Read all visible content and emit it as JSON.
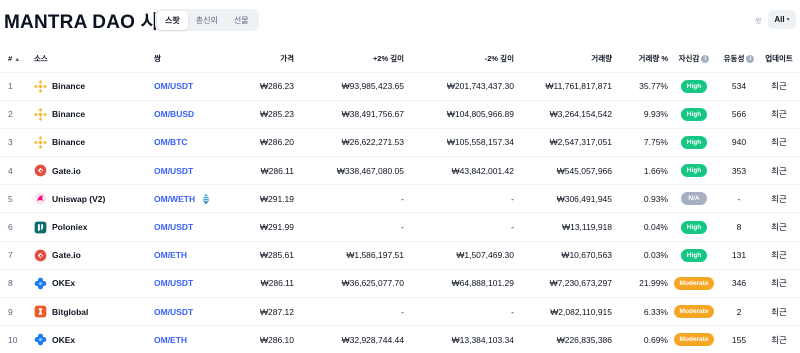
{
  "header": {
    "title": "MANTRA DAO 시장",
    "tabs": [
      {
        "label": "스팟",
        "active": true
      },
      {
        "label": "총신의",
        "active": false
      },
      {
        "label": "선물",
        "active": false
      }
    ],
    "pair_filter_label": "쌍",
    "pair_filter_value": "All"
  },
  "table": {
    "columns": {
      "rank": "#",
      "source": "소스",
      "pair": "쌍",
      "price": "가격",
      "depth_plus": "+2% 깊이",
      "depth_minus": "-2% 깊이",
      "volume": "거래량",
      "volume_pct": "거래량 %",
      "confidence": "자신감",
      "liquidity": "유동성",
      "updated": "업데이트"
    },
    "rows": [
      {
        "rank": "1",
        "source": "Binance",
        "logo": "binance-logo",
        "pair": "OM/USDT",
        "price": "₩286.23",
        "depth_plus": "₩93,985,423.65",
        "depth_minus": "₩201,743,437.30",
        "volume": "₩11,761,817,871",
        "volume_pct": "35.77%",
        "confidence": "High",
        "liquidity": "534",
        "updated": "최근"
      },
      {
        "rank": "2",
        "source": "Binance",
        "logo": "binance-logo",
        "pair": "OM/BUSD",
        "price": "₩285.23",
        "depth_plus": "₩38,491,756.67",
        "depth_minus": "₩104,805,966.89",
        "volume": "₩3,264,154,542",
        "volume_pct": "9.93%",
        "confidence": "High",
        "liquidity": "566",
        "updated": "최근"
      },
      {
        "rank": "3",
        "source": "Binance",
        "logo": "binance-logo",
        "pair": "OM/BTC",
        "price": "₩286.20",
        "depth_plus": "₩26,622,271.53",
        "depth_minus": "₩105,558,157.34",
        "volume": "₩2,547,317,051",
        "volume_pct": "7.75%",
        "confidence": "High",
        "liquidity": "940",
        "updated": "최근"
      },
      {
        "rank": "4",
        "source": "Gate.io",
        "logo": "gateio-logo",
        "pair": "OM/USDT",
        "price": "₩286.11",
        "depth_plus": "₩338,467,080.05",
        "depth_minus": "₩43,842,001.42",
        "volume": "₩545,057,966",
        "volume_pct": "1.66%",
        "confidence": "High",
        "liquidity": "353",
        "updated": "최근"
      },
      {
        "rank": "5",
        "source": "Uniswap (V2)",
        "logo": "uniswap-logo",
        "pair": "OM/WETH",
        "price": "₩291.19",
        "depth_plus": "-",
        "depth_minus": "-",
        "volume": "₩306,491,945",
        "volume_pct": "0.93%",
        "confidence": "N/A",
        "liquidity": "-",
        "updated": "최근"
      },
      {
        "rank": "6",
        "source": "Poloniex",
        "logo": "poloniex-logo",
        "pair": "OM/USDT",
        "price": "₩291.99",
        "depth_plus": "-",
        "depth_minus": "-",
        "volume": "₩13,119,918",
        "volume_pct": "0.04%",
        "confidence": "High",
        "liquidity": "8",
        "updated": "최근"
      },
      {
        "rank": "7",
        "source": "Gate.io",
        "logo": "gateio-logo",
        "pair": "OM/ETH",
        "price": "₩285.61",
        "depth_plus": "₩1,586,197.51",
        "depth_minus": "₩1,507,469.30",
        "volume": "₩10,670,563",
        "volume_pct": "0.03%",
        "confidence": "High",
        "liquidity": "131",
        "updated": "최근"
      },
      {
        "rank": "8",
        "source": "OKEx",
        "logo": "okex-logo",
        "pair": "OM/USDT",
        "price": "₩286.11",
        "depth_plus": "₩36,625,077.70",
        "depth_minus": "₩64,888,101.29",
        "volume": "₩7,230,673,297",
        "volume_pct": "21.99%",
        "confidence": "Moderate",
        "liquidity": "346",
        "updated": "최근"
      },
      {
        "rank": "9",
        "source": "Bitglobal",
        "logo": "bitglobal-logo",
        "pair": "OM/USDT",
        "price": "₩287.12",
        "depth_plus": "-",
        "depth_minus": "-",
        "volume": "₩2,082,110,915",
        "volume_pct": "6.33%",
        "confidence": "Moderate",
        "liquidity": "2",
        "updated": "최근"
      },
      {
        "rank": "10",
        "source": "OKEx",
        "logo": "okex-logo",
        "pair": "OM/ETH",
        "price": "₩286.10",
        "depth_plus": "₩32,928,744.44",
        "depth_minus": "₩13,384,103.34",
        "volume": "₩226,835,386",
        "volume_pct": "0.69%",
        "confidence": "Moderate",
        "liquidity": "155",
        "updated": "최근"
      }
    ]
  },
  "colors": {
    "high": "#16c784",
    "moderate": "#f5a623",
    "na": "#a6b0c3",
    "link": "#3861fb"
  }
}
